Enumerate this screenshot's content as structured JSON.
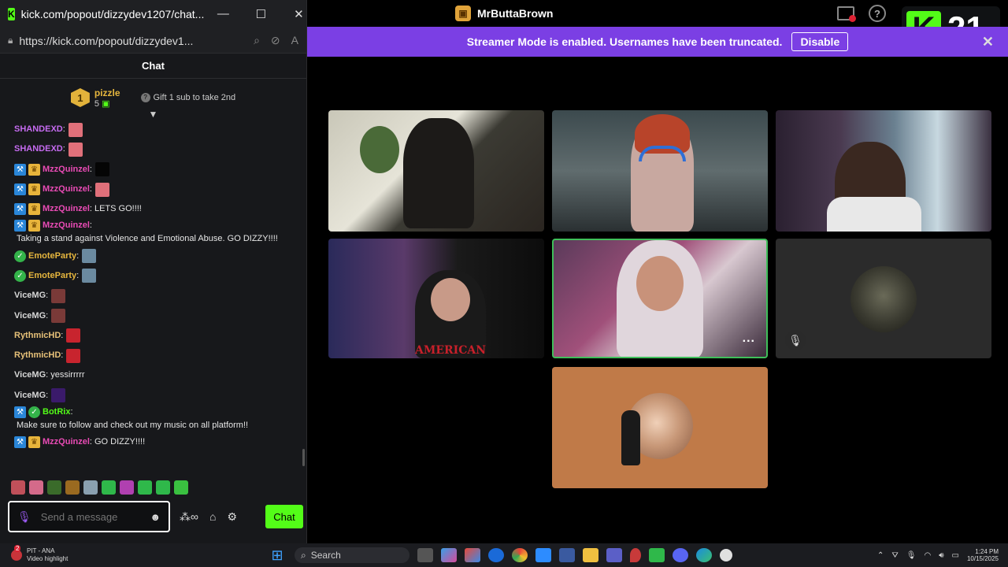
{
  "popup": {
    "title": "kick.com/popout/dizzydev1207/chat...",
    "url": "https://kick.com/popout/dizzydev1...",
    "header": "Chat"
  },
  "leaderboard": {
    "rank": "1",
    "user": "pizzle",
    "subs": "5",
    "gift_text": "Gift 1 sub to take 2nd"
  },
  "messages": [
    {
      "user": "SHANDEXD",
      "color": "#c56bf0",
      "badges": [],
      "text": "",
      "emote": "#e0707a"
    },
    {
      "user": "SHANDEXD",
      "color": "#c56bf0",
      "badges": [],
      "text": "",
      "emote": "#e0707a"
    },
    {
      "user": "MzzQuinzel",
      "color": "#e94bb5",
      "badges": [
        "mod",
        "crown"
      ],
      "text": "",
      "emote": "#050505"
    },
    {
      "user": "MzzQuinzel",
      "color": "#e94bb5",
      "badges": [
        "mod",
        "crown"
      ],
      "text": "",
      "emote": "#e0707a"
    },
    {
      "user": "MzzQuinzel",
      "color": "#e94bb5",
      "badges": [
        "mod",
        "crown"
      ],
      "text": "LETS GO!!!!",
      "emote": ""
    },
    {
      "user": "MzzQuinzel",
      "color": "#e94bb5",
      "badges": [
        "mod",
        "crown"
      ],
      "text": "Taking a stand against Violence and Emotional Abuse. GO DIZZY!!!!",
      "emote": ""
    },
    {
      "user": "EmoteParty",
      "color": "#e6b63e",
      "badges": [
        "verified"
      ],
      "text": "",
      "emote": "#6b8aa0"
    },
    {
      "user": "EmoteParty",
      "color": "#e6b63e",
      "badges": [
        "verified"
      ],
      "text": "",
      "emote": "#6b8aa0"
    },
    {
      "user": "ViceMG",
      "color": "#d8d8d8",
      "badges": [],
      "text": "",
      "emote": "#7a3a38"
    },
    {
      "user": "ViceMG",
      "color": "#d8d8d8",
      "badges": [],
      "text": "",
      "emote": "#7a3a38"
    },
    {
      "user": "RythmicHD",
      "color": "#e6c078",
      "badges": [],
      "text": "",
      "emote": "#c8242e"
    },
    {
      "user": "RythmicHD",
      "color": "#e6c078",
      "badges": [],
      "text": "",
      "emote": "#c8242e"
    },
    {
      "user": "ViceMG",
      "color": "#d8d8d8",
      "badges": [],
      "text": "yessirrrrr",
      "emote": ""
    },
    {
      "user": "ViceMG",
      "color": "#d8d8d8",
      "badges": [],
      "text": "",
      "emote": "#3a1a6a"
    },
    {
      "user": "BotRix",
      "color": "#53fc18",
      "badges": [
        "mod",
        "verified"
      ],
      "text": "Make sure to follow and check out my music on all platform!!",
      "emote": ""
    },
    {
      "user": "MzzQuinzel",
      "color": "#e94bb5",
      "badges": [
        "mod",
        "crown"
      ],
      "text": "GO DIZZY!!!!",
      "emote": ""
    }
  ],
  "emote_row": [
    "#c0505a",
    "#d46a8a",
    "#3a6b2a",
    "#9a6a20",
    "#8aa0b0",
    "#2fb84a",
    "#b040b0",
    "#2fb84a",
    "#2fb84a",
    "#3ac040"
  ],
  "chat_input": {
    "placeholder": "Send a message",
    "send_label": "Chat"
  },
  "main": {
    "app_title": "MrButtaBrown",
    "banner_text": "Streamer Mode is enabled. Usernames have been truncated.",
    "banner_button": "Disable",
    "kick_badge_number": "21",
    "tile_overlay_text": "AMERICAN",
    "tile_more": "..."
  },
  "taskbar": {
    "notif_title": "PIT - ANA",
    "notif_sub": "Video highlight",
    "notif_count": "2",
    "search_label": "Search",
    "time": "1:24 PM",
    "date": "10/15/2025"
  },
  "colors": {
    "kick_green": "#53fc18",
    "banner_purple": "#7b3fe4",
    "active_tile_border": "#3fbf5a"
  }
}
